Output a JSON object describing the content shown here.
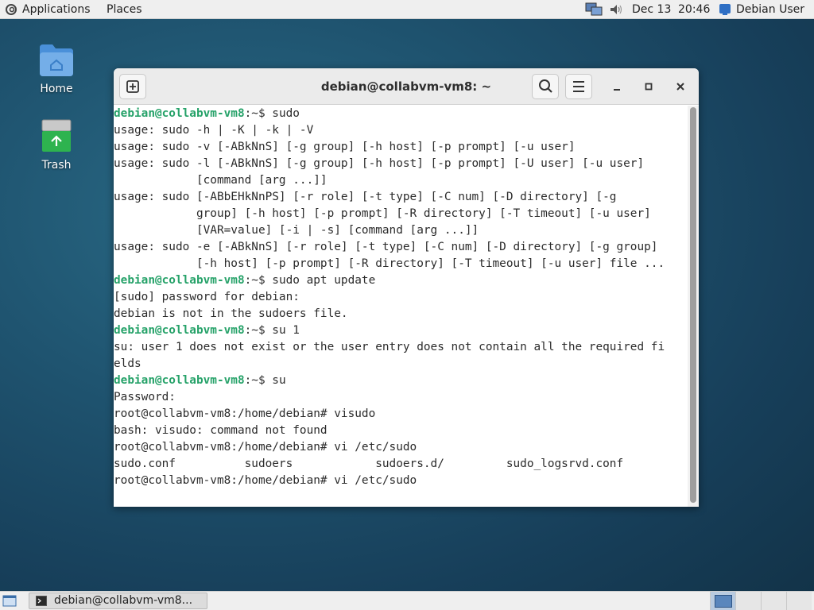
{
  "top_panel": {
    "applications_label": "Applications",
    "places_label": "Places",
    "date": "Dec 13",
    "time": "20:46",
    "user_label": "Debian User"
  },
  "desktop": {
    "icons": [
      {
        "label": "Home",
        "icon": "folder-home-icon"
      },
      {
        "label": "Trash",
        "icon": "trash-icon"
      }
    ]
  },
  "window": {
    "title": "debian@collabvm-vm8: ~",
    "terminal_lines": [
      {
        "prompt": "debian@collabvm-vm8",
        "rest": ":~$ sudo"
      },
      {
        "text": "usage: sudo -h | -K | -k | -V"
      },
      {
        "text": "usage: sudo -v [-ABkNnS] [-g group] [-h host] [-p prompt] [-u user]"
      },
      {
        "text": "usage: sudo -l [-ABkNnS] [-g group] [-h host] [-p prompt] [-U user] [-u user]"
      },
      {
        "text": "            [command [arg ...]]"
      },
      {
        "text": "usage: sudo [-ABbEHkNnPS] [-r role] [-t type] [-C num] [-D directory] [-g"
      },
      {
        "text": "            group] [-h host] [-p prompt] [-R directory] [-T timeout] [-u user]"
      },
      {
        "text": "            [VAR=value] [-i | -s] [command [arg ...]]"
      },
      {
        "text": "usage: sudo -e [-ABkNnS] [-r role] [-t type] [-C num] [-D directory] [-g group]"
      },
      {
        "text": "            [-h host] [-p prompt] [-R directory] [-T timeout] [-u user] file ..."
      },
      {
        "prompt": "debian@collabvm-vm8",
        "rest": ":~$ sudo apt update"
      },
      {
        "text": "[sudo] password for debian:"
      },
      {
        "text": "debian is not in the sudoers file."
      },
      {
        "prompt": "debian@collabvm-vm8",
        "rest": ":~$ su 1"
      },
      {
        "text": "su: user 1 does not exist or the user entry does not contain all the required fi"
      },
      {
        "text": "elds"
      },
      {
        "prompt": "debian@collabvm-vm8",
        "rest": ":~$ su"
      },
      {
        "text": "Password:"
      },
      {
        "text": "root@collabvm-vm8:/home/debian# visudo"
      },
      {
        "text": "bash: visudo: command not found"
      },
      {
        "text": "root@collabvm-vm8:/home/debian# vi /etc/sudo"
      },
      {
        "text": "sudo.conf          sudoers            sudoers.d/         sudo_logsrvd.conf"
      },
      {
        "text": "root@collabvm-vm8:/home/debian# vi /etc/sudo"
      }
    ]
  },
  "taskbar": {
    "task_label": "debian@collabvm-vm8..."
  },
  "colors": {
    "prompt_green": "#26a269",
    "desktop_bg": "#1f5470",
    "panel_bg": "#efefef"
  }
}
